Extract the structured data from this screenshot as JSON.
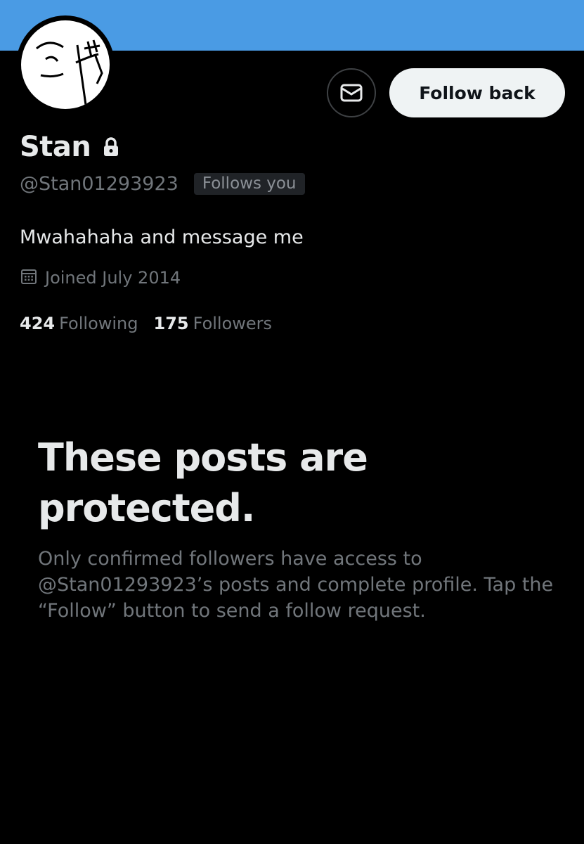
{
  "colors": {
    "banner": "#4a9be4",
    "follow_button_bg": "#eff3f4",
    "background": "#000000"
  },
  "profile": {
    "name": "Stan",
    "handle": "@Stan01293923",
    "follows_you_badge": "Follows you",
    "bio": "Mwahahaha and message me",
    "joined": "Joined July 2014",
    "lock_icon": "lock-icon",
    "calendar_icon": "calendar-icon"
  },
  "actions": {
    "message_icon": "envelope-icon",
    "follow_back_label": "Follow back"
  },
  "stats": {
    "following_count": "424",
    "following_label": "Following",
    "followers_count": "175",
    "followers_label": "Followers"
  },
  "protected": {
    "title": "These posts are protected.",
    "body": "Only confirmed followers have access to @Stan01293923’s posts and complete profile. Tap the “Follow” button to send a follow request."
  }
}
